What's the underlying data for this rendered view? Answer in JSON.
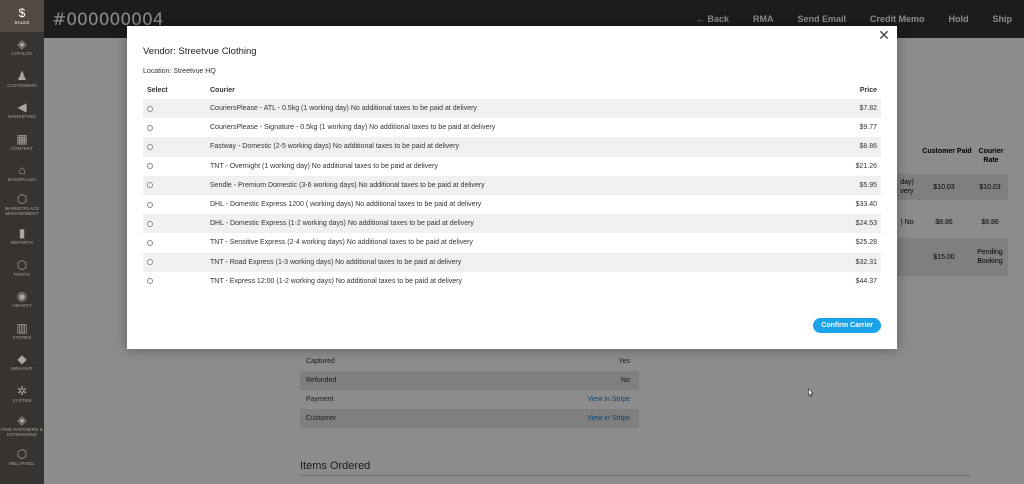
{
  "sidebar": {
    "items": [
      {
        "label": "SALES",
        "icon": "dollar-icon",
        "glyph": "$",
        "active": true
      },
      {
        "label": "CATALOG",
        "icon": "cube-icon",
        "glyph": "◈",
        "active": false
      },
      {
        "label": "CUSTOMERS",
        "icon": "person-icon",
        "glyph": "♟",
        "active": false
      },
      {
        "label": "MARKETING",
        "icon": "megaphone-icon",
        "glyph": "◀",
        "active": false
      },
      {
        "label": "CONTENT",
        "icon": "layout-icon",
        "glyph": "▦",
        "active": false
      },
      {
        "label": "MAGEPLAZA",
        "icon": "mageplaza-icon",
        "glyph": "⌂",
        "active": false
      },
      {
        "label": "MARKETPLACE MANAGEMENT",
        "icon": "hexagon-icon",
        "glyph": "⬡",
        "active": false
      },
      {
        "label": "REPORTS",
        "icon": "bar-chart-icon",
        "glyph": "▮",
        "active": false
      },
      {
        "label": "PORTO",
        "icon": "porto-icon",
        "glyph": "⬡",
        "active": false
      },
      {
        "label": "AMASTY",
        "icon": "amasty-icon",
        "glyph": "◉",
        "active": false
      },
      {
        "label": "STORES",
        "icon": "store-icon",
        "glyph": "▥",
        "active": false
      },
      {
        "label": "MIRASVIT",
        "icon": "mirasvit-icon",
        "glyph": "◆",
        "active": false
      },
      {
        "label": "SYSTEM",
        "icon": "gear-icon",
        "glyph": "✲",
        "active": false
      },
      {
        "label": "FIND PARTNERS & EXTENSIONS",
        "icon": "partners-icon",
        "glyph": "◈",
        "active": false
      },
      {
        "label": "WELTPIXEL",
        "icon": "weltpixel-icon",
        "glyph": "⬡",
        "active": false
      }
    ]
  },
  "header": {
    "title": "#000000004",
    "actions": [
      "← Back",
      "RMA",
      "Send Email",
      "Credit Memo",
      "Hold",
      "Ship"
    ]
  },
  "background": {
    "col_customer_paid": "Customer Paid",
    "col_courier_rate": "Courier Rate",
    "rows": [
      {
        "frag": "day)\nvery",
        "paid": "$10.03",
        "rate": "$10.03"
      },
      {
        "frag": ") No",
        "paid": "$8.86",
        "rate": "$8.86"
      },
      {
        "frag": "",
        "paid": "$15.00",
        "rate": "Pending Booking"
      }
    ],
    "transaction": [
      {
        "label": "Captured",
        "value": "Yes",
        "link": false
      },
      {
        "label": "Refunded",
        "value": "No",
        "link": false
      },
      {
        "label": "Payment",
        "value": "View in Stripe",
        "link": true
      },
      {
        "label": "Customer",
        "value": "View in Stripe",
        "link": true
      }
    ],
    "items_ordered": "Items Ordered"
  },
  "modal": {
    "vendor_title": "Vendor: Streetvue Clothing",
    "location": "Location: Streetvue HQ",
    "columns": {
      "select": "Select",
      "courier": "Courier",
      "price": "Price"
    },
    "rows": [
      {
        "courier": "CouriersPlease - ATL - 0.5kg (1 working day) No additional taxes to be paid at delivery",
        "price": "$7.82"
      },
      {
        "courier": "CouriersPlease - Signature - 0.5kg (1 working day) No additional taxes to be paid at delivery",
        "price": "$9.77"
      },
      {
        "courier": "Fastway - Domestic (2-5 working days) No additional taxes to be paid at delivery",
        "price": "$8.86"
      },
      {
        "courier": "TNT - Overnight (1 working day) No additional taxes to be paid at delivery",
        "price": "$21.26"
      },
      {
        "courier": "Sendle - Premium Domestic (3-6 working days) No additional taxes to be paid at delivery",
        "price": "$5.95"
      },
      {
        "courier": "DHL - Domestic Express 1200 ( working days) No additional taxes to be paid at delivery",
        "price": "$33.40"
      },
      {
        "courier": "DHL - Domestic Express (1-2 working days) No additional taxes to be paid at delivery",
        "price": "$24.53"
      },
      {
        "courier": "TNT - Sensitive Express (2-4 working days) No additional taxes to be paid at delivery",
        "price": "$25.28"
      },
      {
        "courier": "TNT - Road Express (1-3 working days) No additional taxes to be paid at delivery",
        "price": "$32.31"
      },
      {
        "courier": "TNT - Express 12:00 (1-2 working days) No additional taxes to be paid at delivery",
        "price": "$44.37"
      }
    ],
    "confirm_label": "Confirm Carrier",
    "close_glyph": "✕"
  }
}
